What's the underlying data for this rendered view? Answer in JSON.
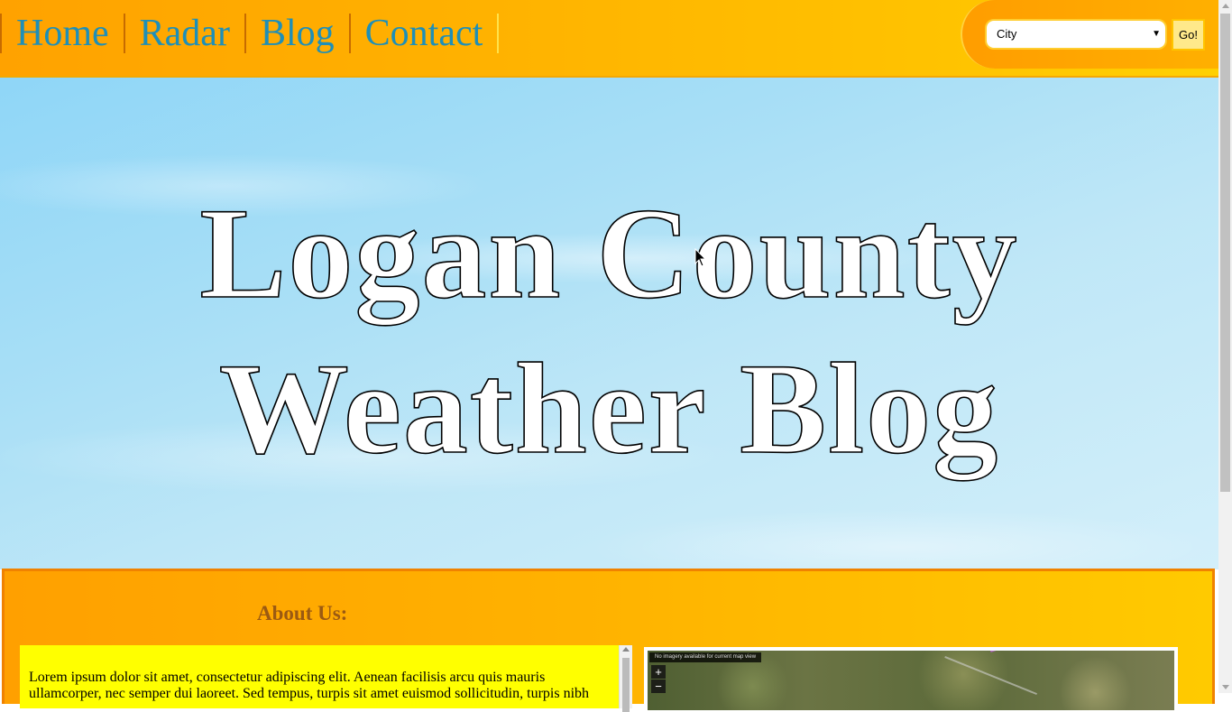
{
  "nav": {
    "items": [
      {
        "label": "Home"
      },
      {
        "label": "Radar"
      },
      {
        "label": "Blog"
      },
      {
        "label": "Contact"
      }
    ],
    "city_select": {
      "selected": "City"
    },
    "go_label": "Go!"
  },
  "hero": {
    "title_line1": "Logan County",
    "title_line2": "Weather Blog"
  },
  "about": {
    "heading": "About Us:",
    "text": "Lorem ipsum dolor sit amet, consectetur adipiscing elit. Aenean facilisis arcu quis mauris ullamcorper, nec semper dui laoreet. Sed tempus, turpis sit amet euismod sollicitudin, turpis nibh"
  },
  "map": {
    "notice": "No imagery available for current map view",
    "zoom_in": "+",
    "zoom_out": "−"
  },
  "colors": {
    "nav_link": "#1e8fb8",
    "nav_bg": "#ffb400",
    "about_heading": "#9b5a12",
    "textbox_bg": "#ffff00"
  }
}
